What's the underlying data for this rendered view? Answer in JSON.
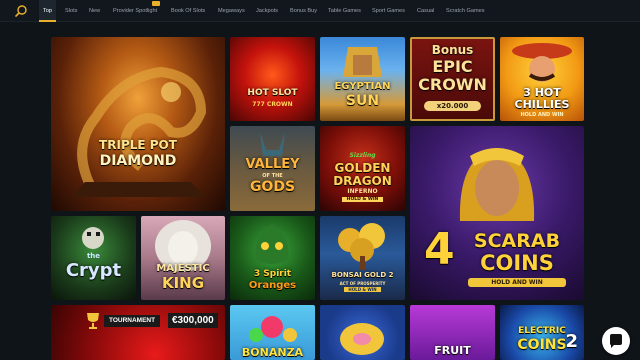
{
  "nav": {
    "tabs": [
      "Top",
      "Slots",
      "New",
      "Provider Spotlight",
      "Book Of Slots",
      "Megaways",
      "Jackpots",
      "Bonus Buy",
      "Table Games",
      "Sport Games",
      "Casual",
      "Scratch Games"
    ],
    "active_tab": "Top"
  },
  "games": {
    "triple_pot": {
      "line1": "TRIPLE POT",
      "line2": "DIAMOND"
    },
    "hot_slot": {
      "line1": "HOT SLOT",
      "line2": "777 CROWN"
    },
    "egyptian_sun": {
      "line1": "EGYPTIAN",
      "line2": "SUN"
    },
    "epic_crown": {
      "line1": "Bonus",
      "line2": "EPIC",
      "line3": "CROWN",
      "line4": "x20.000"
    },
    "hot_chillies": {
      "line1": "3 HOT",
      "line2": "CHILLIES",
      "line3": "HOLD AND WIN"
    },
    "valley_gods": {
      "line1": "VALLEY",
      "line2": "OF THE",
      "line3": "GODS"
    },
    "golden_dragon": {
      "line1": "Sizzling",
      "line2": "GOLDEN",
      "line3": "DRAGON",
      "line4": "INFERNO",
      "line5": "HOLD & WIN"
    },
    "scarab_coins": {
      "line1": "4",
      "line2": "SCARAB",
      "line3": "COINS",
      "line4": "HOLD AND WIN"
    },
    "crypt": {
      "line1": "the",
      "line2": "Crypt"
    },
    "majestic_king": {
      "line1": "MAJESTIC",
      "line2": "KING"
    },
    "spirit_oranges": {
      "line1": "3 Spirit",
      "line2": "Oranges"
    },
    "bonsai_gold": {
      "line1": "BONSAI GOLD 2",
      "line2": "ACT OF PROSPERITY",
      "line3": "HOLD & WIN"
    },
    "bonanza": {
      "line1": "BONANZA"
    },
    "fruit": {
      "line1": "FRUIT"
    },
    "electric_coins": {
      "line1": "ELECTRIC",
      "line2": "COINS",
      "line3": "2"
    }
  },
  "tournament": {
    "label": "TOURNAMENT",
    "prize": "€300,000"
  },
  "colors": {
    "accent": "#e8b02a",
    "background": "#0f1419"
  }
}
